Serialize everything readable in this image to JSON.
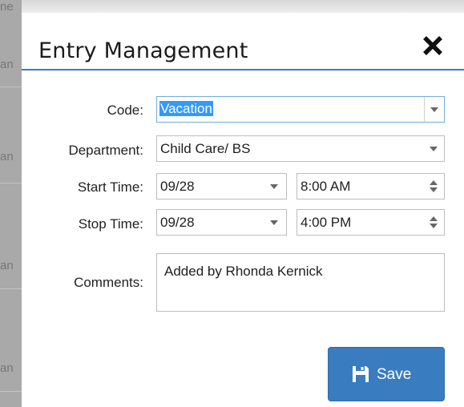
{
  "background": {
    "fragments": [
      "ne",
      "an",
      "an",
      "an",
      "an"
    ]
  },
  "dialog": {
    "title": "Entry Management",
    "close_icon": "close-icon",
    "fields": {
      "code": {
        "label": "Code:",
        "value": "Vacation"
      },
      "department": {
        "label": "Department:",
        "value": "Child Care/ BS"
      },
      "start_time": {
        "label": "Start Time:",
        "date": "09/28",
        "time": "8:00 AM"
      },
      "stop_time": {
        "label": "Stop Time:",
        "date": "09/28",
        "time": "4:00 PM"
      },
      "comments": {
        "label": "Comments:",
        "value": "Added by Rhonda Kernick"
      }
    },
    "save_button": {
      "label": "Save",
      "icon": "floppy-disk-icon"
    }
  },
  "colors": {
    "accent": "#3a7cc4",
    "save_button": "#3a7cc0",
    "selection": "#3399ff",
    "background_strip": "#a9a9a9"
  }
}
